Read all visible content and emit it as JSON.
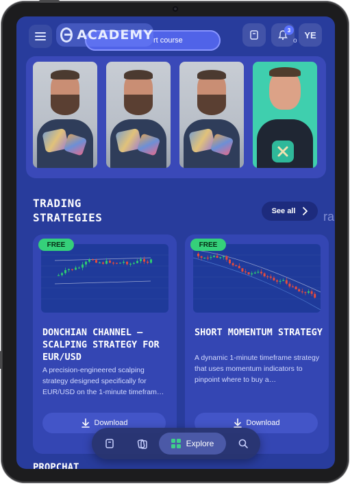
{
  "header": {
    "logo_text": "ACADEMY",
    "course_pill_text": "rt course",
    "notification_count": "3",
    "avatar_initials": "YE",
    "pro_fragment": "o"
  },
  "video_carousel": {
    "thumbnails": [
      {
        "label": "video-1"
      },
      {
        "label": "video-2"
      },
      {
        "label": "video-3"
      },
      {
        "label": "video-4"
      }
    ]
  },
  "trading_strategies": {
    "title": "TRADING\nSTRATEGIES",
    "see_all_label": "See all",
    "edge_fragment": "ra",
    "cards": [
      {
        "badge": "FREE",
        "title": "DONCHIAN CHANNEL — SCALPING STRATEGY FOR EUR/USD",
        "description": "A precision-engineered scalping strategy designed specifically for EUR/USD on the 1-minute timefram…",
        "download_label": "Download"
      },
      {
        "badge": "FREE",
        "title": "SHORT MOMENTUM STRATEGY",
        "description": "A dynamic 1-minute timeframe strategy that uses momentum indicators to pinpoint where to buy a…",
        "download_label": "Download"
      }
    ]
  },
  "next_section_title": "PROPCHAT",
  "bottom_nav": {
    "explore_label": "Explore"
  },
  "colors": {
    "background": "#283c9c",
    "card": "#3446b3",
    "free_badge": "#35d07a",
    "bullish": "#2ecc71",
    "bearish": "#e74c3c"
  }
}
